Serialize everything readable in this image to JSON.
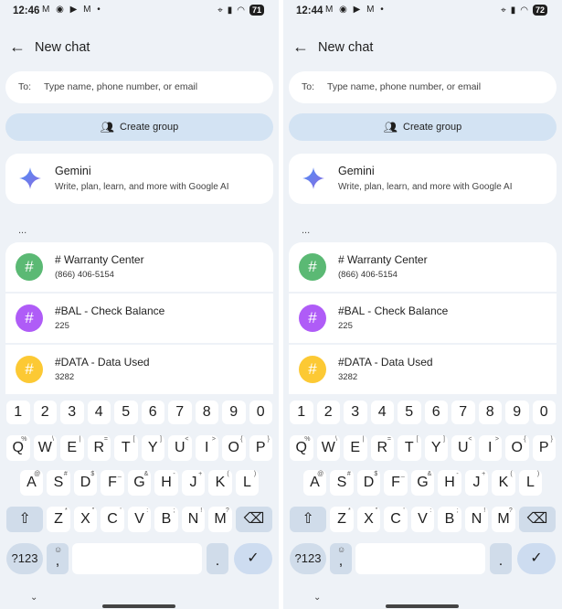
{
  "panels": [
    {
      "status": {
        "time": "12:46",
        "notifications": "M ◉ ▶ M •",
        "battery": "71"
      },
      "header": {
        "title": "New chat"
      },
      "to_field": {
        "label": "To:",
        "placeholder": "Type name, phone number, or email"
      },
      "create_group": {
        "label": "Create group"
      },
      "gemini": {
        "name": "Gemini",
        "description": "Write, plan, learn, and more with Google AI"
      },
      "section": {
        "ellipsis": "..."
      },
      "contacts": [
        {
          "name": "# Warranty Center",
          "number": "(866) 406-5154",
          "avatar": "#",
          "color": "#5bb974"
        },
        {
          "name": "#BAL - Check Balance",
          "number": "225",
          "avatar": "#",
          "color": "#af5cf7"
        },
        {
          "name": "#DATA - Data Used",
          "number": "3282",
          "avatar": "#",
          "color": "#fcc934"
        }
      ],
      "nav": {
        "chevron": "⌄"
      }
    },
    {
      "status": {
        "time": "12:44",
        "notifications": "M ◉ ▶ M •",
        "battery": "72"
      },
      "header": {
        "title": "New chat"
      },
      "to_field": {
        "label": "To:",
        "placeholder": "Type name, phone number, or email"
      },
      "create_group": {
        "label": "Create group"
      },
      "gemini": {
        "name": "Gemini",
        "description": "Write, plan, learn, and more with Google AI"
      },
      "section": {
        "ellipsis": "..."
      },
      "contacts": [
        {
          "name": "# Warranty Center",
          "number": "(866) 406-5154",
          "avatar": "#",
          "color": "#5bb974"
        },
        {
          "name": "#BAL - Check Balance",
          "number": "225",
          "avatar": "#",
          "color": "#af5cf7"
        },
        {
          "name": "#DATA - Data Used",
          "number": "3282",
          "avatar": "#",
          "color": "#fcc934"
        }
      ],
      "nav": {
        "chevron": "⌄"
      }
    }
  ],
  "keyboard": {
    "number_row": [
      "1",
      "2",
      "3",
      "4",
      "5",
      "6",
      "7",
      "8",
      "9",
      "0"
    ],
    "row1": [
      {
        "k": "Q",
        "h": "%"
      },
      {
        "k": "W",
        "h": "\\"
      },
      {
        "k": "E",
        "h": "|"
      },
      {
        "k": "R",
        "h": "="
      },
      {
        "k": "T",
        "h": "["
      },
      {
        "k": "Y",
        "h": "]"
      },
      {
        "k": "U",
        "h": "<"
      },
      {
        "k": "I",
        "h": ">"
      },
      {
        "k": "O",
        "h": "{"
      },
      {
        "k": "P",
        "h": "}"
      }
    ],
    "row2": [
      {
        "k": "A",
        "h": "@"
      },
      {
        "k": "S",
        "h": "#"
      },
      {
        "k": "D",
        "h": "$"
      },
      {
        "k": "F",
        "h": "_"
      },
      {
        "k": "G",
        "h": "&"
      },
      {
        "k": "H",
        "h": "-"
      },
      {
        "k": "J",
        "h": "+"
      },
      {
        "k": "K",
        "h": "("
      },
      {
        "k": "L",
        "h": ")"
      }
    ],
    "row3": [
      {
        "k": "Z",
        "h": "*"
      },
      {
        "k": "X",
        "h": "\""
      },
      {
        "k": "C",
        "h": "'"
      },
      {
        "k": "V",
        "h": ":"
      },
      {
        "k": "B",
        "h": ";"
      },
      {
        "k": "N",
        "h": "!"
      },
      {
        "k": "M",
        "h": "?"
      }
    ],
    "symbols_label": "?123",
    "emoji_comma": ",",
    "period": ".",
    "shift_icon": "⇧",
    "backspace_icon": "⌫",
    "enter_icon": "✓",
    "emoji_icon": "☺"
  },
  "colors": {
    "background": "#eef2f7",
    "card": "#ffffff",
    "create_group": "#d3e3f3",
    "func_key": "#d0dcea"
  }
}
